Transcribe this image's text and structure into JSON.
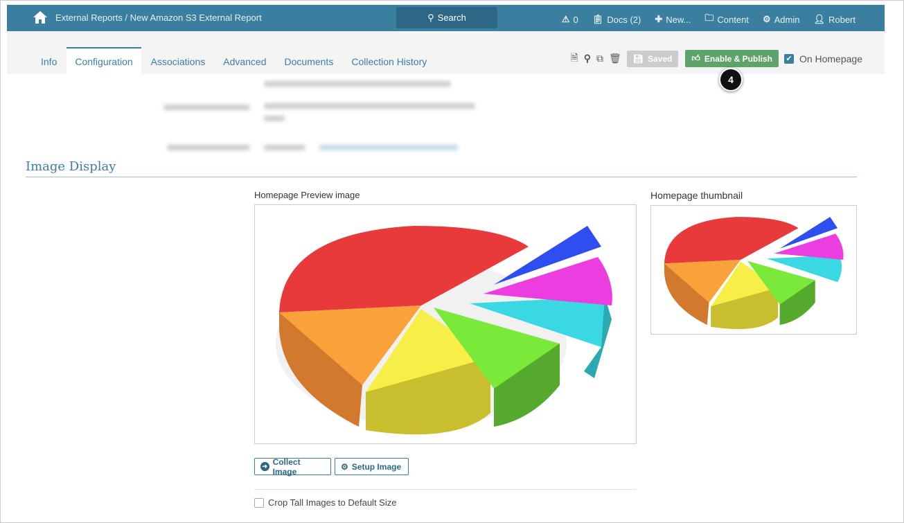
{
  "topbar": {
    "breadcrumb": "External Reports / New Amazon S3 External Report",
    "search": "Search",
    "alerts": "0",
    "docs": "Docs (2)",
    "new": "New...",
    "content": "Content",
    "admin": "Admin",
    "user": "Robert"
  },
  "tabs": [
    "Info",
    "Configuration",
    "Associations",
    "Advanced",
    "Documents",
    "Collection History"
  ],
  "toolbar": {
    "saved": "Saved",
    "publish": "Enable & Publish",
    "on_homepage": "On Homepage",
    "step_badge": "4"
  },
  "section": {
    "title": "Image Display",
    "preview_label": "Homepage Preview image",
    "thumb_label": "Homepage thumbnail",
    "collect": "Collect Image",
    "setup": "Setup Image",
    "crop": "Crop Tall Images to Default Size"
  },
  "colors": {
    "brand": "#3a7fa0",
    "publish": "#5da36a"
  }
}
